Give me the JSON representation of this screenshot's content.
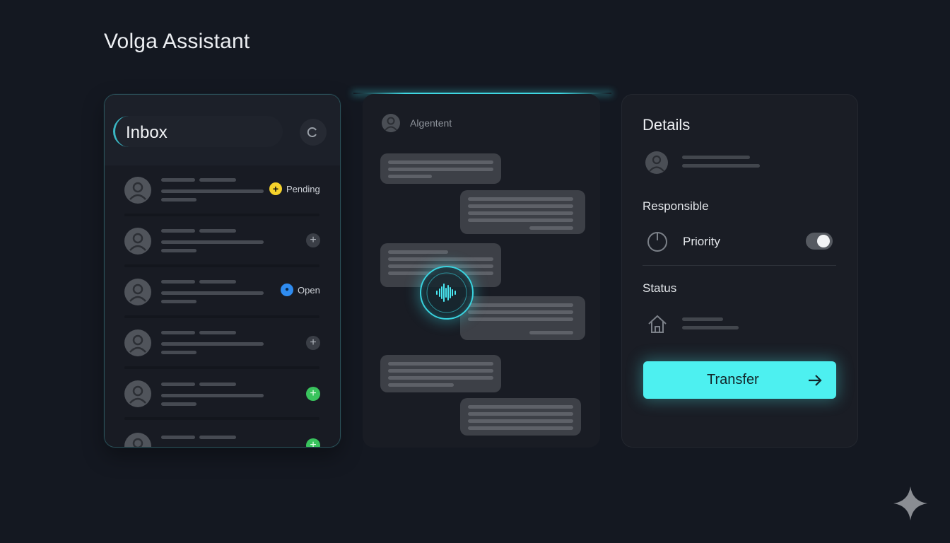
{
  "app": {
    "title": "Volga Assistant"
  },
  "inbox": {
    "title": "Inbox",
    "refresh_icon": "refresh-icon",
    "rows": [
      {
        "badge": "Pending",
        "badge_icon": "plus-icon",
        "badge_color": "#f5d22b"
      },
      {
        "badge": "",
        "badge_icon": "plus-icon",
        "badge_color": "#3a3e46"
      },
      {
        "badge": "Open",
        "badge_icon": "drop-icon",
        "badge_color": "#2f8cf0"
      },
      {
        "badge": "",
        "badge_icon": "plus-icon",
        "badge_color": "#3a3e46"
      },
      {
        "badge": "",
        "badge_icon": "plus-icon",
        "badge_color": "#39c35d"
      },
      {
        "badge": "",
        "badge_icon": "plus-icon",
        "badge_color": "#39c35d"
      }
    ]
  },
  "chat": {
    "agent_label": "Algentent",
    "voice_icon": "waveform-icon",
    "accent": "#39d3df"
  },
  "details": {
    "title": "Details",
    "responsible_label": "Responsible",
    "priority_label": "Priority",
    "priority_enabled": true,
    "status_label": "Status",
    "status_icon": "home-icon",
    "transfer_label": "Transfer",
    "transfer_color": "#4df0f0"
  },
  "corner_icon": "sparkle-icon"
}
